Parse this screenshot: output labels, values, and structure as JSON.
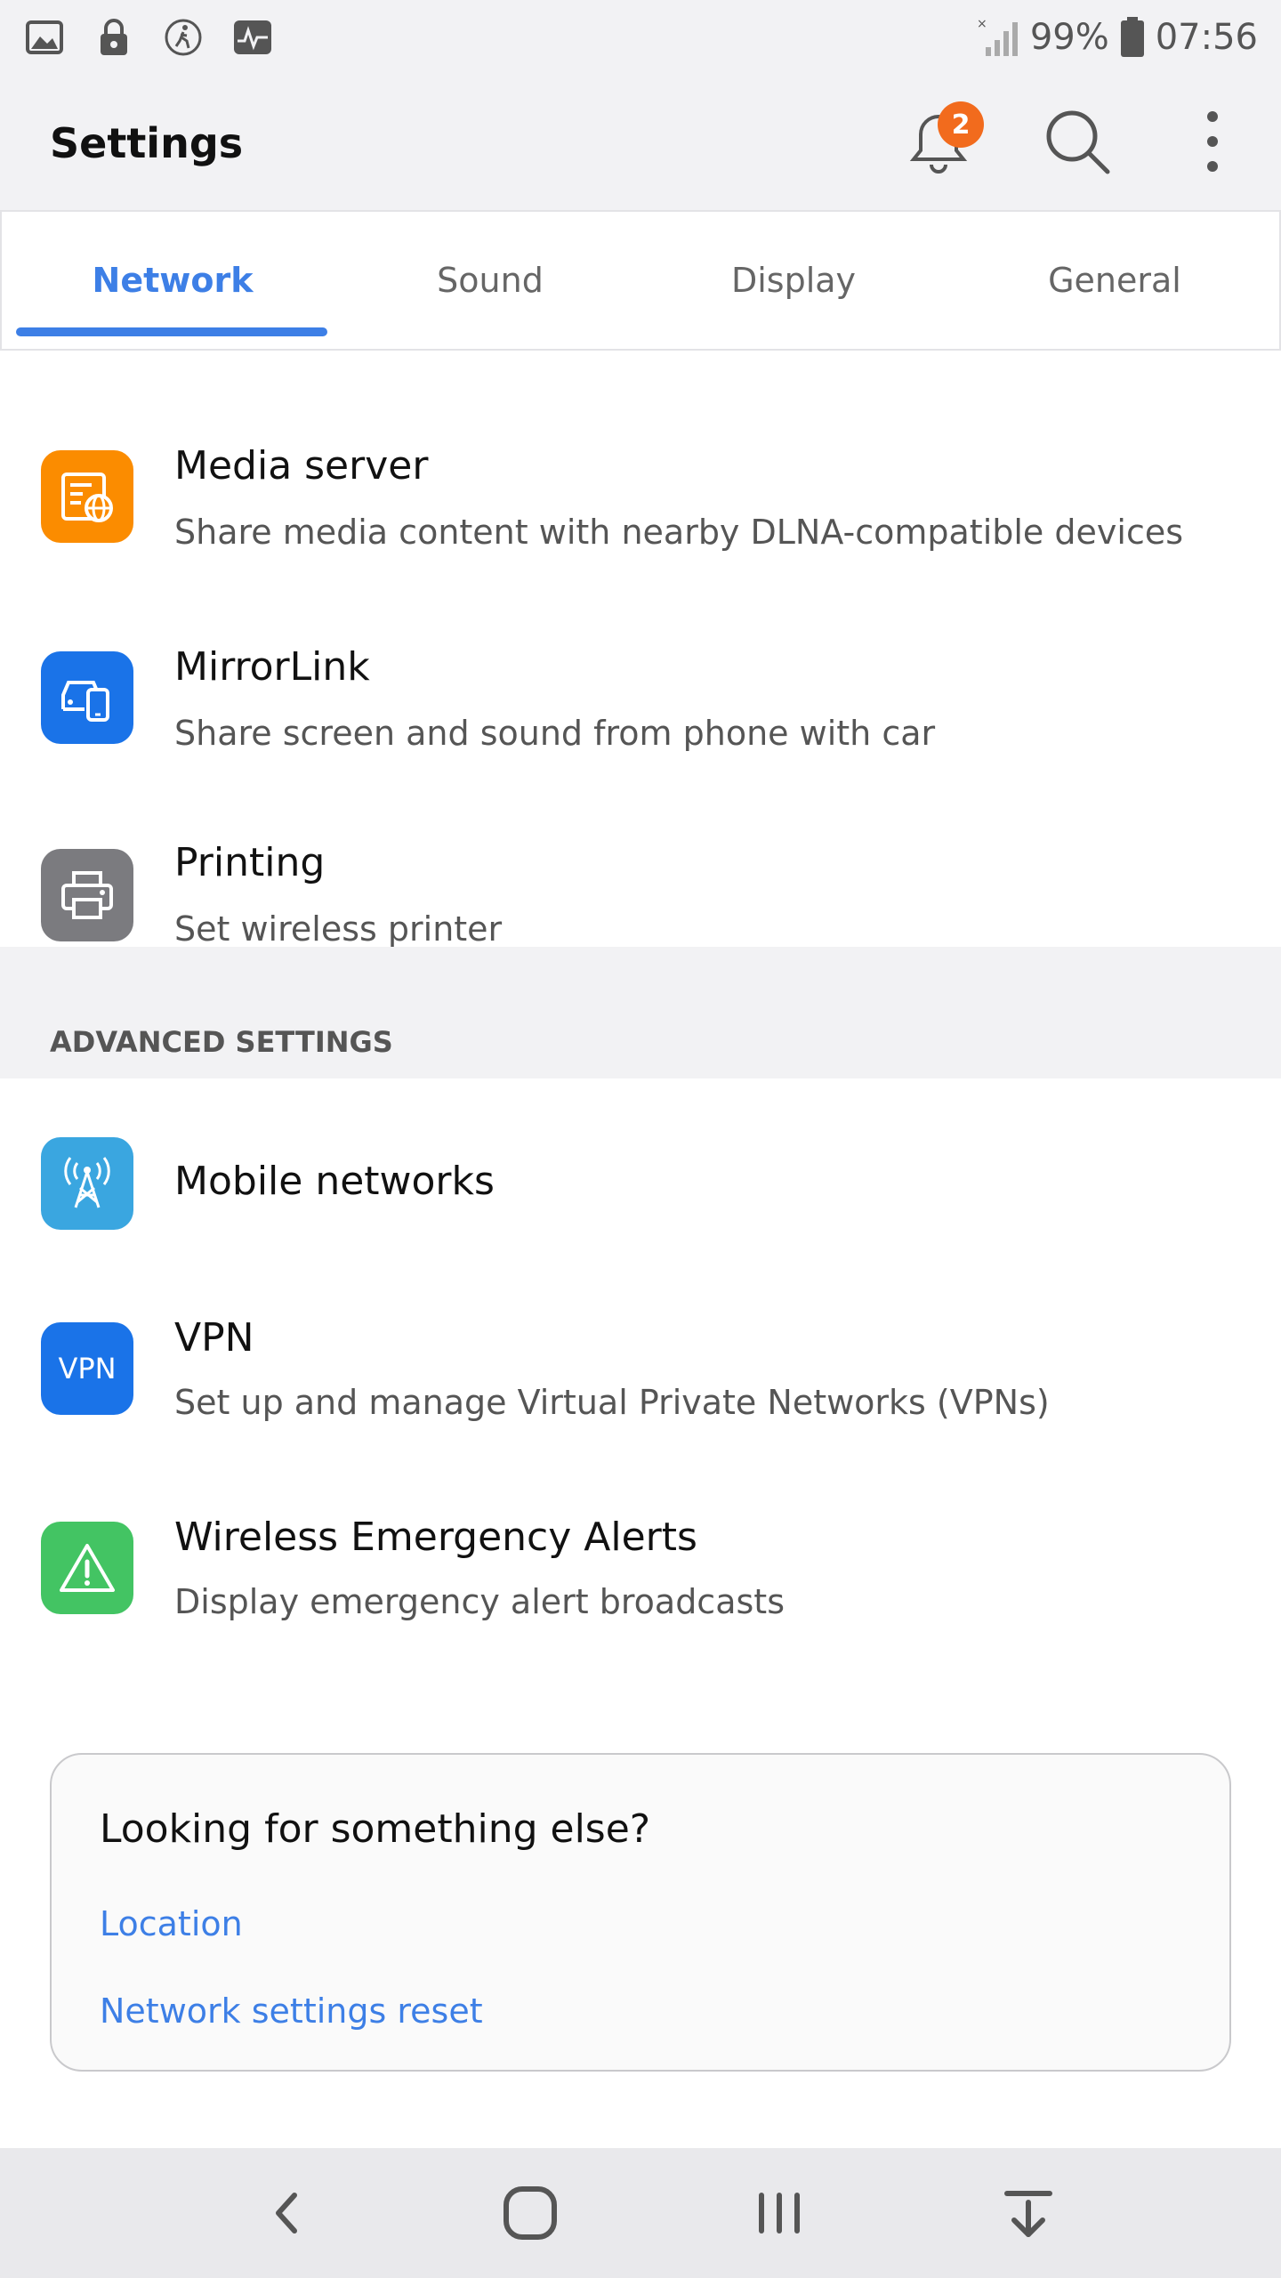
{
  "status_bar": {
    "battery": "99%",
    "time": "07:56"
  },
  "header": {
    "title": "Settings",
    "notification_count": "2"
  },
  "tabs": [
    {
      "label": "Network",
      "active": true
    },
    {
      "label": "Sound",
      "active": false
    },
    {
      "label": "Display",
      "active": false
    },
    {
      "label": "General",
      "active": false
    }
  ],
  "items": [
    {
      "title": "Media server",
      "subtitle": "Share media content with nearby DLNA-compatible devices",
      "icon": "media-server-icon",
      "color": "#fb8c00"
    },
    {
      "title": "MirrorLink",
      "subtitle": "Share screen and sound from phone with car",
      "icon": "car-phone-icon",
      "color": "#1a73e8"
    },
    {
      "title": "Printing",
      "subtitle": "Set wireless printer",
      "icon": "printer-icon",
      "color": "#7b7b7f"
    }
  ],
  "advanced": {
    "header": "ADVANCED SETTINGS",
    "items": [
      {
        "title": "Mobile networks",
        "subtitle": "",
        "icon": "antenna-icon",
        "color": "#3aa6e0"
      },
      {
        "title": "VPN",
        "subtitle": "Set up and manage Virtual Private Networks (VPNs)",
        "icon": "vpn-icon",
        "icon_text": "VPN",
        "color": "#1a73e8"
      },
      {
        "title": "Wireless Emergency Alerts",
        "subtitle": "Display emergency alert broadcasts",
        "icon": "warning-icon",
        "color": "#43c463"
      }
    ]
  },
  "card": {
    "title": "Looking for something else?",
    "links": [
      "Location",
      "Network settings reset"
    ]
  },
  "colors": {
    "accent": "#3d7fe6",
    "badge": "#f26b1d"
  }
}
